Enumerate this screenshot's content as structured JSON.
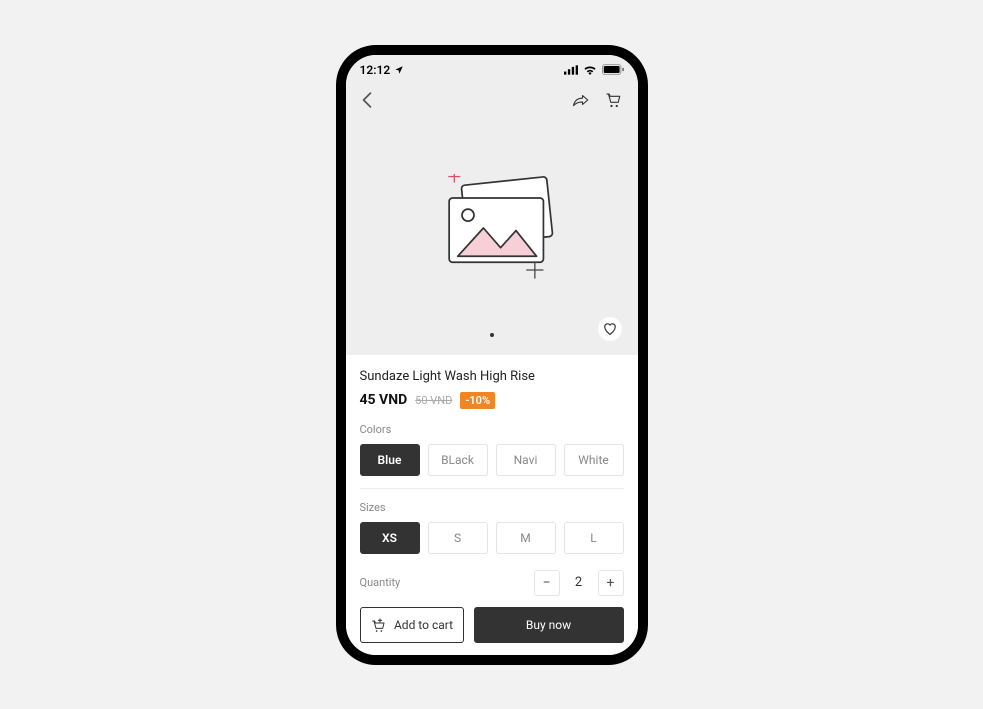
{
  "status": {
    "time": "12:12"
  },
  "product": {
    "title": "Sundaze Light Wash High Rise",
    "price": "45 VND",
    "old_price": "50 VND",
    "discount": "-10%"
  },
  "colors": {
    "label": "Colors",
    "options": [
      "Blue",
      "BLack",
      "Navi",
      "White"
    ]
  },
  "sizes": {
    "label": "Sizes",
    "options": [
      "XS",
      "S",
      "M",
      "L"
    ]
  },
  "quantity": {
    "label": "Quantity",
    "minus": "−",
    "value": "2",
    "plus": "+"
  },
  "actions": {
    "add_to_cart": "Add to cart",
    "buy_now": "Buy now"
  }
}
